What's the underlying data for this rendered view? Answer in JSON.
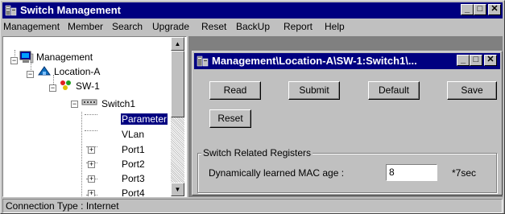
{
  "window": {
    "title": "Switch Management",
    "app_icon": "network-app-icon",
    "controls": {
      "minimize": "_",
      "maximize": "□",
      "close": "✕"
    }
  },
  "menubar": {
    "items": [
      "Management",
      "Member",
      "Search",
      "Upgrade",
      "Reset",
      "BackUp",
      "Report",
      "Help"
    ]
  },
  "tree": {
    "nodes": [
      {
        "label": "Management",
        "icon": "computer-icon",
        "expander": "−"
      },
      {
        "label": "Location-A",
        "icon": "location-icon",
        "expander": "−"
      },
      {
        "label": "SW-1",
        "icon": "device-group-icon",
        "expander": "−"
      },
      {
        "label": "Switch1",
        "icon": "switch-icon",
        "expander": "−"
      },
      {
        "label": "Parameter",
        "selected": true
      },
      {
        "label": "VLan"
      },
      {
        "label": "Port1",
        "expander": "+"
      },
      {
        "label": "Port2",
        "expander": "+"
      },
      {
        "label": "Port3",
        "expander": "+"
      },
      {
        "label": "Port4",
        "expander": "+"
      }
    ],
    "scroll_up": "▲",
    "scroll_down": "▼"
  },
  "child_window": {
    "title": "Management\\Location-A\\SW-1:Switch1\\...",
    "controls": {
      "minimize": "_",
      "maximize": "□",
      "close": "✕"
    },
    "buttons": {
      "read": "Read",
      "submit": "Submit",
      "default": "Default",
      "save": "Save",
      "reset": "Reset"
    },
    "group": {
      "label": "Switch Related Registers",
      "field_label": "Dynamically learned MAC age :",
      "field_value": "8",
      "unit": "*7sec"
    }
  },
  "status": {
    "text": "Connection Type : Internet"
  },
  "colors": {
    "title_bar": "#000080",
    "face": "#c0c0c0",
    "selection": "#000080"
  }
}
